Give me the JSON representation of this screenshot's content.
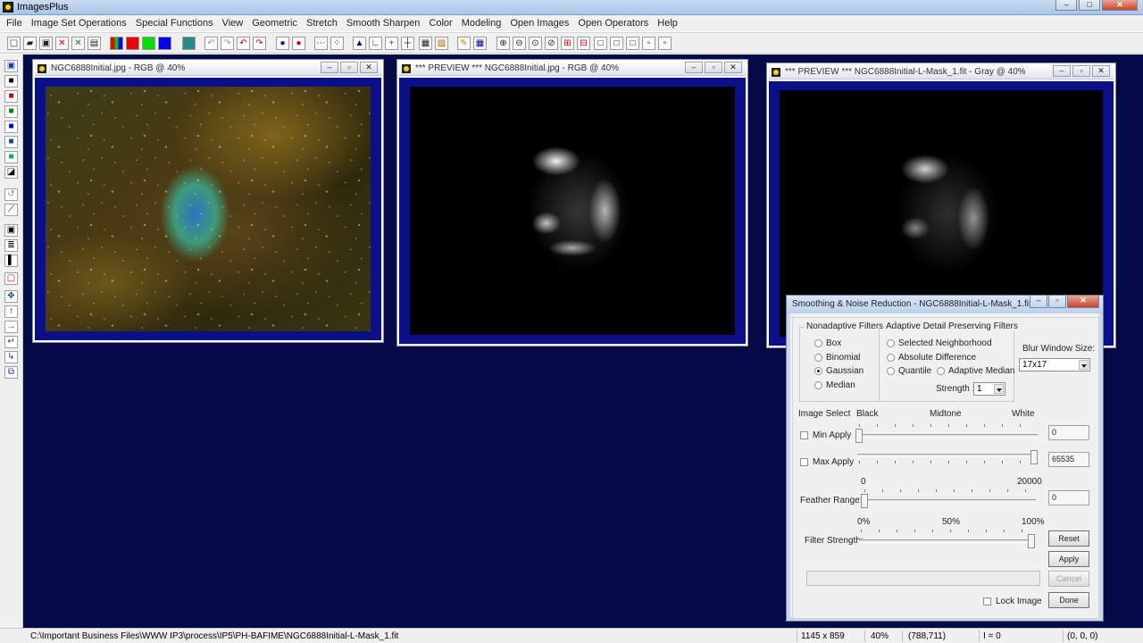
{
  "app": {
    "title": "ImagesPlus",
    "window_buttons": [
      "–",
      "□",
      "✕"
    ]
  },
  "menu": [
    "File",
    "Image Set Operations",
    "Special Functions",
    "View",
    "Geometric",
    "Stretch",
    "Smooth Sharpen",
    "Color",
    "Modeling",
    "Open Images",
    "Open Operators",
    "Help"
  ],
  "windows": [
    {
      "title": "NGC6888Initial.jpg - RGB @ 40%",
      "image": "color"
    },
    {
      "title": "*** PREVIEW *** NGC6888Initial.jpg - RGB @ 40%",
      "image": "mask-preview"
    },
    {
      "title": "*** PREVIEW *** NGC6888Initial-L-Mask_1.fit - Gray @ 40%",
      "image": "mask-gray"
    }
  ],
  "dialog": {
    "title": "Smoothing & Noise Reduction - NGC6888Initial-L-Mask_1.fit",
    "nonadaptive": {
      "label": "Nonadaptive Filters",
      "options": [
        "Box",
        "Binomial",
        "Gaussian",
        "Median"
      ],
      "selected": "Gaussian"
    },
    "adaptive": {
      "label": "Adaptive Detail Preserving Filters",
      "options": [
        "Selected Neighborhood",
        "Absolute Difference",
        "Quantile",
        "Adaptive Median"
      ],
      "strength_label": "Strength :",
      "strength_value": "1"
    },
    "blur": {
      "label": "Blur Window Size:",
      "value": "17x17"
    },
    "image_select": {
      "label": "Image Select",
      "black": "Black",
      "midtone": "Midtone",
      "white": "White",
      "min_label": "Min Apply",
      "min_value": "0",
      "min_position": 0.0,
      "max_label": "Max Apply",
      "max_value": "65535",
      "max_position": 1.0
    },
    "feather": {
      "label": "Feather Range:",
      "range_min": "0",
      "range_max": "20000",
      "value": "0",
      "position": 0.0
    },
    "strength": {
      "label": "Filter Strength:",
      "p0": "0%",
      "p50": "50%",
      "p100": "100%",
      "position": 1.0
    },
    "buttons": {
      "reset": "Reset",
      "apply": "Apply",
      "cancel": "Cancel",
      "done": "Done"
    },
    "lock_image": "Lock Image"
  },
  "status": {
    "path": "C:\\Important Business Files\\WWW IP3\\process\\IP5\\PH-BAFIME\\NGC6888Initial-L-Mask_1.fit",
    "dimensions": "1145 x 859",
    "zoom": "40%",
    "coords": "(788,711)",
    "intensity": "I = 0",
    "rgb": "(0, 0, 0)"
  }
}
